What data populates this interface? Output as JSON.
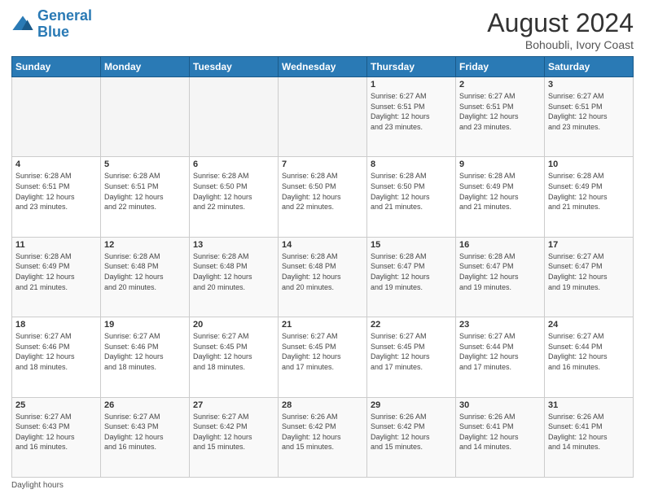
{
  "header": {
    "logo_line1": "General",
    "logo_line2": "Blue",
    "main_title": "August 2024",
    "subtitle": "Bohoubli, Ivory Coast"
  },
  "calendar": {
    "days_of_week": [
      "Sunday",
      "Monday",
      "Tuesday",
      "Wednesday",
      "Thursday",
      "Friday",
      "Saturday"
    ],
    "weeks": [
      [
        {
          "day": "",
          "info": ""
        },
        {
          "day": "",
          "info": ""
        },
        {
          "day": "",
          "info": ""
        },
        {
          "day": "",
          "info": ""
        },
        {
          "day": "1",
          "info": "Sunrise: 6:27 AM\nSunset: 6:51 PM\nDaylight: 12 hours\nand 23 minutes."
        },
        {
          "day": "2",
          "info": "Sunrise: 6:27 AM\nSunset: 6:51 PM\nDaylight: 12 hours\nand 23 minutes."
        },
        {
          "day": "3",
          "info": "Sunrise: 6:27 AM\nSunset: 6:51 PM\nDaylight: 12 hours\nand 23 minutes."
        }
      ],
      [
        {
          "day": "4",
          "info": "Sunrise: 6:28 AM\nSunset: 6:51 PM\nDaylight: 12 hours\nand 23 minutes."
        },
        {
          "day": "5",
          "info": "Sunrise: 6:28 AM\nSunset: 6:51 PM\nDaylight: 12 hours\nand 22 minutes."
        },
        {
          "day": "6",
          "info": "Sunrise: 6:28 AM\nSunset: 6:50 PM\nDaylight: 12 hours\nand 22 minutes."
        },
        {
          "day": "7",
          "info": "Sunrise: 6:28 AM\nSunset: 6:50 PM\nDaylight: 12 hours\nand 22 minutes."
        },
        {
          "day": "8",
          "info": "Sunrise: 6:28 AM\nSunset: 6:50 PM\nDaylight: 12 hours\nand 21 minutes."
        },
        {
          "day": "9",
          "info": "Sunrise: 6:28 AM\nSunset: 6:49 PM\nDaylight: 12 hours\nand 21 minutes."
        },
        {
          "day": "10",
          "info": "Sunrise: 6:28 AM\nSunset: 6:49 PM\nDaylight: 12 hours\nand 21 minutes."
        }
      ],
      [
        {
          "day": "11",
          "info": "Sunrise: 6:28 AM\nSunset: 6:49 PM\nDaylight: 12 hours\nand 21 minutes."
        },
        {
          "day": "12",
          "info": "Sunrise: 6:28 AM\nSunset: 6:48 PM\nDaylight: 12 hours\nand 20 minutes."
        },
        {
          "day": "13",
          "info": "Sunrise: 6:28 AM\nSunset: 6:48 PM\nDaylight: 12 hours\nand 20 minutes."
        },
        {
          "day": "14",
          "info": "Sunrise: 6:28 AM\nSunset: 6:48 PM\nDaylight: 12 hours\nand 20 minutes."
        },
        {
          "day": "15",
          "info": "Sunrise: 6:28 AM\nSunset: 6:47 PM\nDaylight: 12 hours\nand 19 minutes."
        },
        {
          "day": "16",
          "info": "Sunrise: 6:28 AM\nSunset: 6:47 PM\nDaylight: 12 hours\nand 19 minutes."
        },
        {
          "day": "17",
          "info": "Sunrise: 6:27 AM\nSunset: 6:47 PM\nDaylight: 12 hours\nand 19 minutes."
        }
      ],
      [
        {
          "day": "18",
          "info": "Sunrise: 6:27 AM\nSunset: 6:46 PM\nDaylight: 12 hours\nand 18 minutes."
        },
        {
          "day": "19",
          "info": "Sunrise: 6:27 AM\nSunset: 6:46 PM\nDaylight: 12 hours\nand 18 minutes."
        },
        {
          "day": "20",
          "info": "Sunrise: 6:27 AM\nSunset: 6:45 PM\nDaylight: 12 hours\nand 18 minutes."
        },
        {
          "day": "21",
          "info": "Sunrise: 6:27 AM\nSunset: 6:45 PM\nDaylight: 12 hours\nand 17 minutes."
        },
        {
          "day": "22",
          "info": "Sunrise: 6:27 AM\nSunset: 6:45 PM\nDaylight: 12 hours\nand 17 minutes."
        },
        {
          "day": "23",
          "info": "Sunrise: 6:27 AM\nSunset: 6:44 PM\nDaylight: 12 hours\nand 17 minutes."
        },
        {
          "day": "24",
          "info": "Sunrise: 6:27 AM\nSunset: 6:44 PM\nDaylight: 12 hours\nand 16 minutes."
        }
      ],
      [
        {
          "day": "25",
          "info": "Sunrise: 6:27 AM\nSunset: 6:43 PM\nDaylight: 12 hours\nand 16 minutes."
        },
        {
          "day": "26",
          "info": "Sunrise: 6:27 AM\nSunset: 6:43 PM\nDaylight: 12 hours\nand 16 minutes."
        },
        {
          "day": "27",
          "info": "Sunrise: 6:27 AM\nSunset: 6:42 PM\nDaylight: 12 hours\nand 15 minutes."
        },
        {
          "day": "28",
          "info": "Sunrise: 6:26 AM\nSunset: 6:42 PM\nDaylight: 12 hours\nand 15 minutes."
        },
        {
          "day": "29",
          "info": "Sunrise: 6:26 AM\nSunset: 6:42 PM\nDaylight: 12 hours\nand 15 minutes."
        },
        {
          "day": "30",
          "info": "Sunrise: 6:26 AM\nSunset: 6:41 PM\nDaylight: 12 hours\nand 14 minutes."
        },
        {
          "day": "31",
          "info": "Sunrise: 6:26 AM\nSunset: 6:41 PM\nDaylight: 12 hours\nand 14 minutes."
        }
      ]
    ]
  },
  "footer": {
    "note": "Daylight hours"
  }
}
